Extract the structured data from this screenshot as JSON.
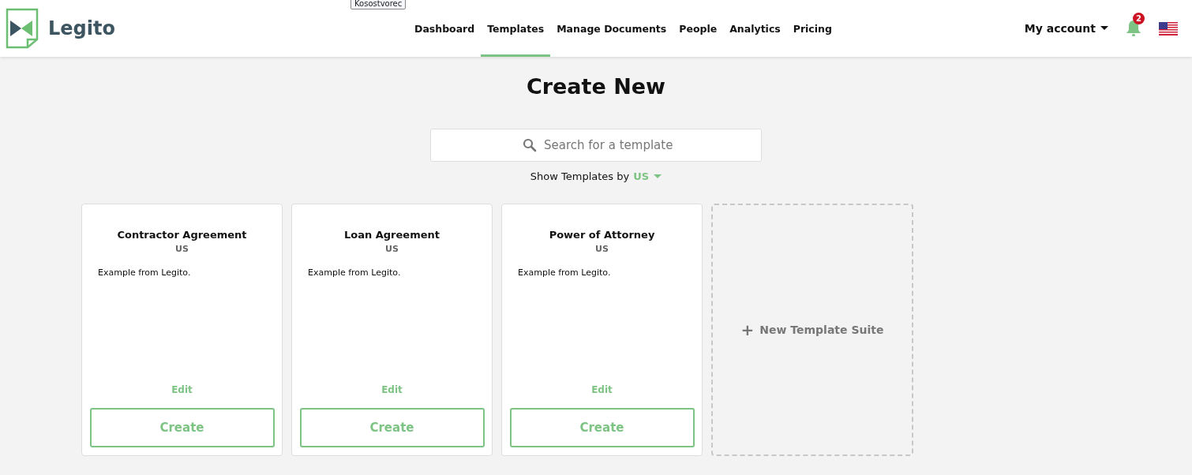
{
  "header": {
    "logo": "Legito",
    "tooltip": "Kosostvorec",
    "nav": [
      {
        "label": "Dashboard",
        "selected": false
      },
      {
        "label": "Templates",
        "selected": true
      },
      {
        "label": "Manage Documents",
        "selected": false
      },
      {
        "label": "People",
        "selected": false
      },
      {
        "label": "Analytics",
        "selected": false
      },
      {
        "label": "Pricing",
        "selected": false
      }
    ],
    "account": "My account",
    "notification_count": "2"
  },
  "title": "Create New",
  "search": {
    "placeholder": "Search for a template"
  },
  "filter": {
    "label": "Show Templates by",
    "value": "US"
  },
  "cards": [
    {
      "title": "Contractor Agreement",
      "region": "US",
      "description": "Example from Legito.",
      "edit": "Edit",
      "create": "Create"
    },
    {
      "title": "Loan Agreement",
      "region": "US",
      "description": "Example from Legito.",
      "edit": "Edit",
      "create": "Create"
    },
    {
      "title": "Power of Attorney",
      "region": "US",
      "description": "Example from Legito.",
      "edit": "Edit",
      "create": "Create"
    }
  ],
  "new_suite": {
    "plus": "+",
    "label": "New Template Suite"
  }
}
